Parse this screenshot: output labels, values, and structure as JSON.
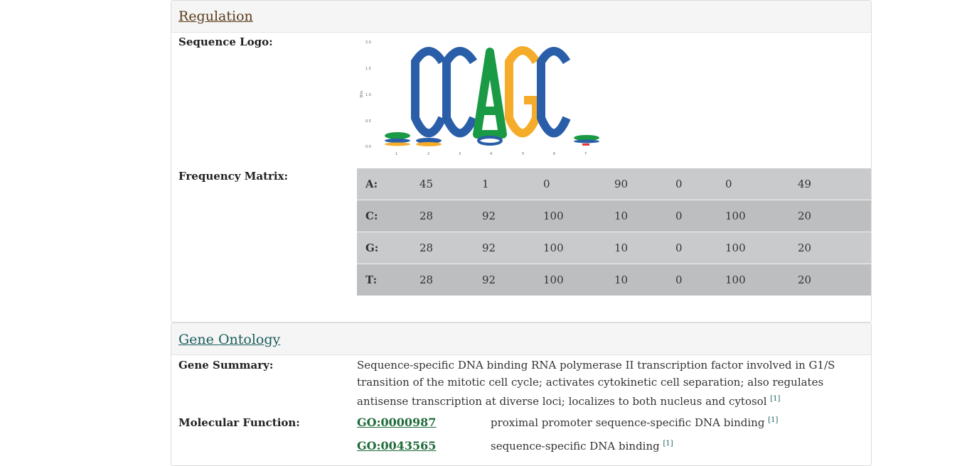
{
  "regulation": {
    "title": "Regulation",
    "sequence_logo_label": "Sequence Logo:",
    "frequency_matrix_label": "Frequency Matrix:",
    "logo": {
      "y_label": "Bits",
      "y_ticks": [
        "2.0",
        "1.5",
        "1.0",
        "0.5",
        "0.0"
      ],
      "x_ticks": [
        "1",
        "2",
        "3",
        "4",
        "5",
        "6",
        "7"
      ]
    },
    "matrix": [
      {
        "base": "A:",
        "values": [
          "45",
          "1",
          "0",
          "90",
          "0",
          "0",
          "49"
        ]
      },
      {
        "base": "C:",
        "values": [
          "28",
          "92",
          "100",
          "10",
          "0",
          "100",
          "20"
        ]
      },
      {
        "base": "G:",
        "values": [
          "28",
          "92",
          "100",
          "10",
          "0",
          "100",
          "20"
        ]
      },
      {
        "base": "T:",
        "values": [
          "28",
          "92",
          "100",
          "10",
          "0",
          "100",
          "20"
        ]
      }
    ]
  },
  "gene_ontology": {
    "title": "Gene Ontology",
    "gene_summary_label": "Gene Summary:",
    "gene_summary": "Sequence-specific DNA binding RNA polymerase II transcription factor involved in G1/S transition of the mitotic cell cycle; activates cytokinetic cell separation; also regulates antisense transcription at diverse loci; localizes to both nucleus and cytosol",
    "ref": "[1]",
    "molecular_function_label": "Molecular Function:",
    "terms": [
      {
        "id": "GO:0000987",
        "desc": "proximal promoter sequence-specific DNA binding",
        "ref": "[1]"
      },
      {
        "id": "GO:0043565",
        "desc": "sequence-specific DNA binding",
        "ref": "[1]"
      }
    ]
  },
  "colors": {
    "A": "#1a9a45",
    "C": "#2a5ea8",
    "G": "#f4ac2a",
    "T": "#e03a3a"
  }
}
